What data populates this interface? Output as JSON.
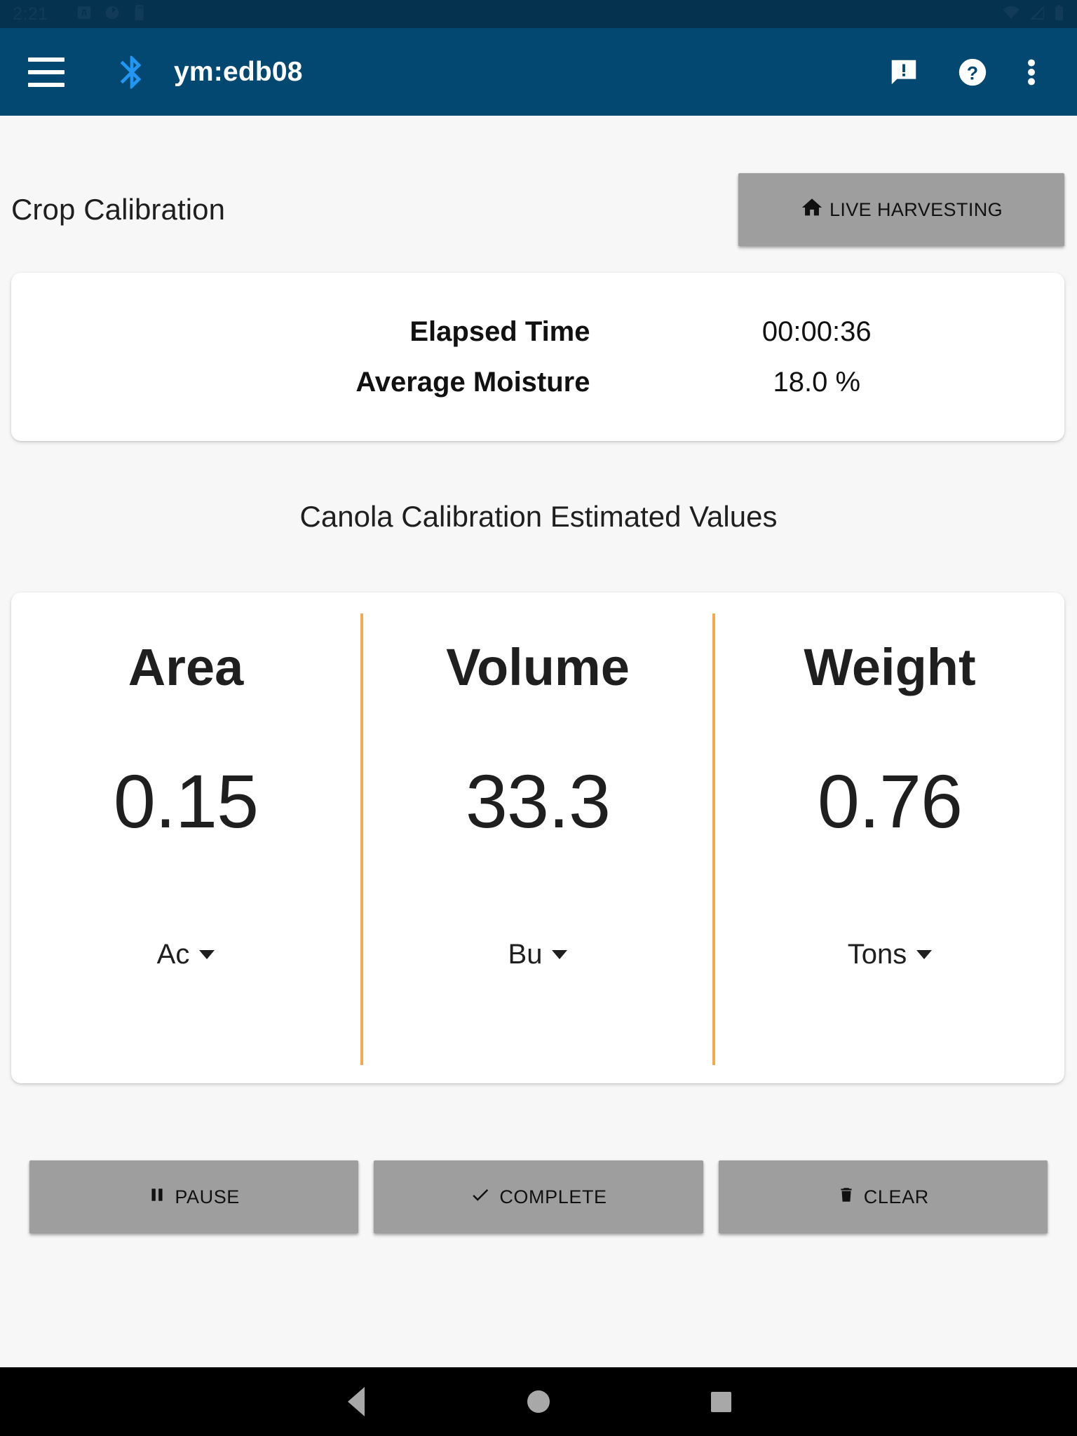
{
  "status_bar": {
    "clock": "2:21",
    "left_icons": [
      "app-badge-icon",
      "circle-app-icon",
      "sd-card-icon"
    ],
    "right_icons": [
      "wifi-icon",
      "cellular-signal-icon",
      "battery-icon"
    ]
  },
  "toolbar": {
    "menu_icon": "hamburger-menu-icon",
    "bluetooth_icon": "bluetooth-icon",
    "title": "ym:edb08",
    "actions": [
      {
        "name": "feedback-icon",
        "label": "Feedback"
      },
      {
        "name": "help-icon",
        "label": "Help"
      },
      {
        "name": "overflow-menu-icon",
        "label": "More options"
      }
    ],
    "background_color": "#034871",
    "bluetooth_color": "#2196f3"
  },
  "page": {
    "title": "Crop Calibration",
    "live_harvesting_button": {
      "label": "LIVE HARVESTING",
      "icon": "home-icon"
    }
  },
  "summary": {
    "rows": [
      {
        "label": "Elapsed Time",
        "value": "00:00:36"
      },
      {
        "label": "Average Moisture",
        "value": "18.0 %"
      }
    ]
  },
  "section_title": "Canola Calibration Estimated Values",
  "values": {
    "divider_color": "#f5a94f",
    "columns": [
      {
        "name": "Area",
        "value": "0.15",
        "unit": "Ac"
      },
      {
        "name": "Volume",
        "value": "33.3",
        "unit": "Bu"
      },
      {
        "name": "Weight",
        "value": "0.76",
        "unit": "Tons"
      }
    ]
  },
  "actions": [
    {
      "label": "PAUSE",
      "icon": "pause-icon"
    },
    {
      "label": "COMPLETE",
      "icon": "check-icon"
    },
    {
      "label": "CLEAR",
      "icon": "trash-icon"
    }
  ],
  "nav_bar": {
    "back": "back-triangle-icon",
    "home": "home-circle-icon",
    "recents": "recents-square-icon"
  },
  "colors": {
    "status_bar": "#05324f",
    "toolbar": "#034871",
    "page_background": "#f7f7f7",
    "card": "#ffffff",
    "button_gray": "#9e9e9e",
    "accent_orange": "#f5a94f"
  }
}
